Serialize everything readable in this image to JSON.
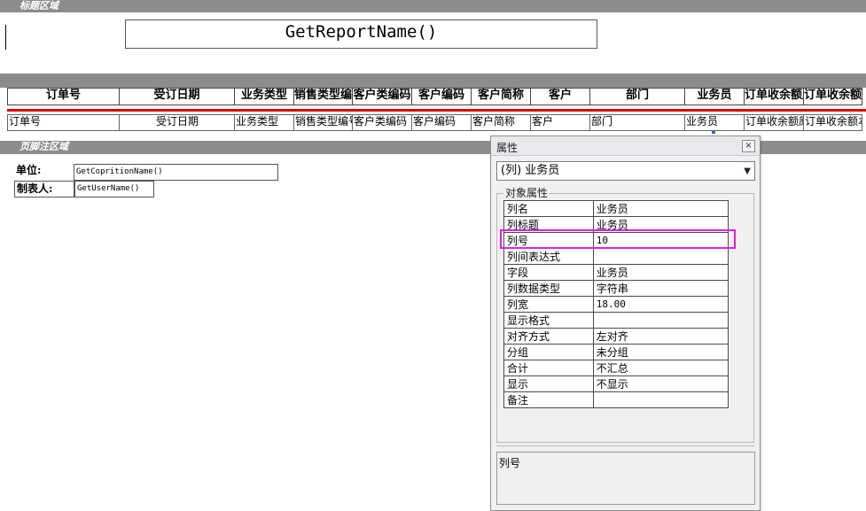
{
  "bands": {
    "title_band": "标题区域",
    "footer_band": "页脚注区域"
  },
  "report_title": "GetReportName()",
  "header_cells": [
    {
      "label": "订单号",
      "w": 126
    },
    {
      "label": "受订日期",
      "w": 130
    },
    {
      "label": "业务类型",
      "w": 67
    },
    {
      "label": "销售类型编号",
      "w": 66
    },
    {
      "label": "客户类编码",
      "w": 67
    },
    {
      "label": "客户编码",
      "w": 67
    },
    {
      "label": "客户简称",
      "w": 67
    },
    {
      "label": "客户",
      "w": 67
    },
    {
      "label": "部门",
      "w": 107
    },
    {
      "label": "业务员",
      "w": 67
    },
    {
      "label": "订单收余额原币",
      "w": 67
    },
    {
      "label": "订单收余额本币",
      "w": 67
    }
  ],
  "detail_cells": [
    {
      "label": "订单号",
      "align": "left"
    },
    {
      "label": "受订日期",
      "align": "center"
    },
    {
      "label": "业务类型",
      "align": "left"
    },
    {
      "label": "销售类型编号",
      "align": "left"
    },
    {
      "label": "客户类编码",
      "align": "left"
    },
    {
      "label": "客户编码",
      "align": "left"
    },
    {
      "label": "客户简称",
      "align": "left"
    },
    {
      "label": "客户",
      "align": "left"
    },
    {
      "label": "部门",
      "align": "left"
    },
    {
      "label": "业务员",
      "align": "left"
    },
    {
      "label": "订单收余额原币",
      "align": "left"
    },
    {
      "label": "订单收余额本币",
      "align": "left"
    }
  ],
  "footer": {
    "unit_label": "单位:",
    "unit_value": "GetCopritionName()",
    "maker_label": "制表人:",
    "maker_value": "GetUserName()"
  },
  "dialog": {
    "title": "属性",
    "close_symbol": "×",
    "combo_value": "(列)   业务员",
    "group_label": "对象属性",
    "properties": [
      {
        "name": "列名",
        "value": "业务员"
      },
      {
        "name": "列标题",
        "value": "业务员"
      },
      {
        "name": "列号",
        "value": "10"
      },
      {
        "name": "列间表达式",
        "value": ""
      },
      {
        "name": "字段",
        "value": "业务员"
      },
      {
        "name": "列数据类型",
        "value": "字符串"
      },
      {
        "name": "列宽",
        "value": "18.00"
      },
      {
        "name": "显示格式",
        "value": ""
      },
      {
        "name": "对齐方式",
        "value": "左对齐"
      },
      {
        "name": "分组",
        "value": "未分组"
      },
      {
        "name": "合计",
        "value": "不汇总"
      },
      {
        "name": "显示",
        "value": "不显示"
      },
      {
        "name": "备注",
        "value": ""
      }
    ],
    "description": "列号",
    "highlight_color": "#e020e0"
  }
}
